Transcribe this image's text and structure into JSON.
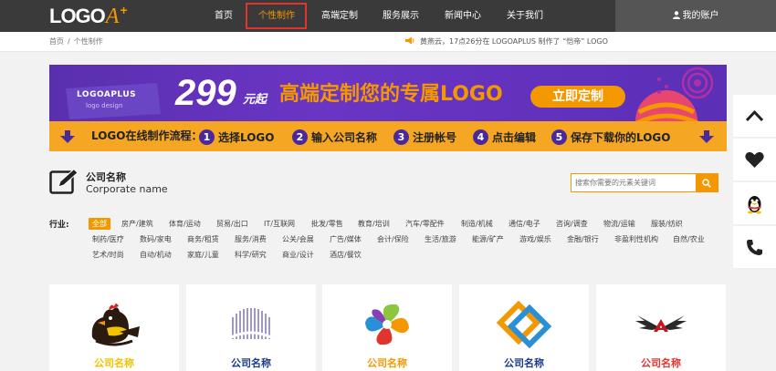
{
  "header": {
    "logo": {
      "text": "LOGO",
      "mark": "A",
      "plus": "+"
    },
    "nav": [
      {
        "label": "首页",
        "active": false
      },
      {
        "label": "个性制作",
        "active": true
      },
      {
        "label": "高端定制",
        "active": false
      },
      {
        "label": "服务展示",
        "active": false
      },
      {
        "label": "新闻中心",
        "active": false
      },
      {
        "label": "关于我们",
        "active": false
      }
    ],
    "account_label": "我的账户",
    "account_icon": "user-icon",
    "colors": {
      "bar": "#3a3a3a",
      "accent": "#f39800",
      "highlight": "#e0342c"
    }
  },
  "subbar": {
    "breadcrumb": [
      "首页",
      "/",
      "个性制作"
    ],
    "notice_icon": "megaphone-icon",
    "notice": "黄燕云，17点26分在 LOGOAPLUS 制作了 “恺帝” LOGO"
  },
  "banner": {
    "brand": "LOGOAPLUS",
    "brand_sub": "logo design",
    "price": "299",
    "price_unit": "元起",
    "slogan": "高端定制您的专属LOGO",
    "cta": "立即定制",
    "flow_label": "LOGO在线制作流程：",
    "steps": [
      {
        "num": "1",
        "text": "选择LOGO"
      },
      {
        "num": "2",
        "text": "输入公司名称"
      },
      {
        "num": "3",
        "text": "注册帐号"
      },
      {
        "num": "4",
        "text": "点击编辑"
      },
      {
        "num": "5",
        "text": "保存下载你的LOGO"
      }
    ]
  },
  "company": {
    "title_cn": "公司名称",
    "title_en": "Corporate name",
    "icon": "edit-icon"
  },
  "search": {
    "placeholder": "搜索你需要的元素关键词",
    "icon": "search-icon"
  },
  "industry": {
    "label": "行业:",
    "rows": [
      [
        "全部",
        "房产/建筑",
        "体育/运动",
        "贸易/出口",
        "IT/互联网",
        "批发/零售",
        "教育/培训",
        "汽车/零配件",
        "制造/机械",
        "通信/电子",
        "咨询/调查",
        "物流/运输",
        "服装/纺织"
      ],
      [
        "制药/医疗",
        "数码/家电",
        "商务/租赁",
        "服务/消费",
        "公关/会展",
        "广告/媒体",
        "会计/保险",
        "生活/旅游",
        "能源/矿产",
        "游戏/娱乐",
        "金融/银行",
        "非盈利性机构",
        "自然/农业"
      ],
      [
        "艺术/时尚",
        "自动/机动",
        "家庭/儿童",
        "科学/研究",
        "商业/设计",
        "酒店/餐饮"
      ]
    ],
    "selected": "全部"
  },
  "cards": [
    {
      "name": "公司名称",
      "color": "#f3c200",
      "icon": "chicken-logo-icon"
    },
    {
      "name": "公司名称",
      "color": "#1a3b8a",
      "icon": "building-logo-icon"
    },
    {
      "name": "公司名称",
      "color": "#f39800",
      "icon": "swirl-logo-icon"
    },
    {
      "name": "公司名称",
      "color": "#1a3b8a",
      "icon": "diamond-logo-icon"
    },
    {
      "name": "公司名称",
      "color": "#e0342c",
      "icon": "wings-logo-icon"
    }
  ],
  "side_tools": [
    "chevron-up-icon",
    "heart-icon",
    "qq-penguin-icon",
    "phone-icon"
  ]
}
